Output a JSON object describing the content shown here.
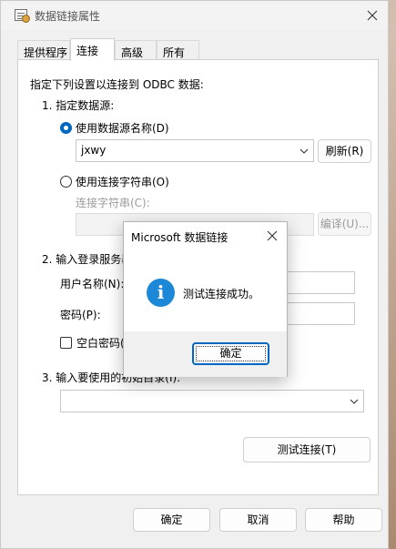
{
  "window": {
    "title": "数据链接属性",
    "tabs": [
      {
        "label": "提供程序",
        "active": false
      },
      {
        "label": "连接",
        "active": true
      },
      {
        "label": "高级",
        "active": false
      },
      {
        "label": "所有",
        "active": false
      }
    ]
  },
  "connection": {
    "intro": "指定下列设置以连接到 ODBC 数据:",
    "step1_label": "1. 指定数据源:",
    "use_dsn_label": "使用数据源名称(D)",
    "use_dsn_checked": true,
    "dsn_value": "jxwy",
    "refresh_label": "刷新(R)",
    "use_connstr_label": "使用连接字符串(O)",
    "use_connstr_checked": false,
    "connstr_label": "连接字符串(C):",
    "connstr_value": "",
    "edit_label": "编译(U)...",
    "step2_label": "2. 输入登录服务器",
    "username_label": "用户名称(N):",
    "username_value": "",
    "password_label": "密码(P):",
    "password_value": "",
    "blank_password_label": "空白密码(",
    "blank_password_checked": false,
    "step3_label": "3. 输入要使用的初始目录(I):",
    "catalog_value": "",
    "test_connection_label": "测试连接(T)"
  },
  "footer": {
    "ok_label": "确定",
    "cancel_label": "取消",
    "help_label": "帮助"
  },
  "dialog": {
    "title": "Microsoft 数据链接",
    "message": "测试连接成功。",
    "icon": "info-icon",
    "ok_label": "确定"
  }
}
